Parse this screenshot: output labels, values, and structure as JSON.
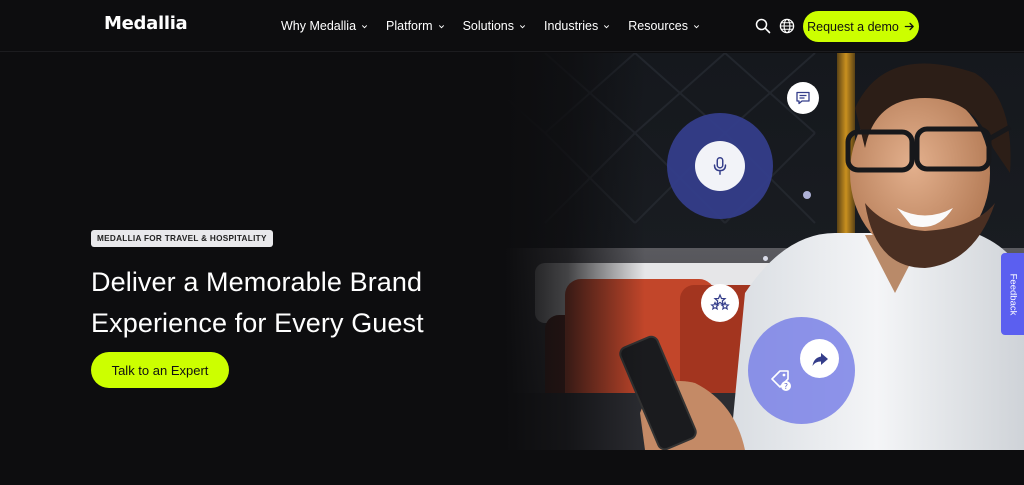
{
  "header": {
    "logo": "Medallia",
    "nav": [
      {
        "label": "Why Medallia"
      },
      {
        "label": "Platform"
      },
      {
        "label": "Solutions"
      },
      {
        "label": "Industries"
      },
      {
        "label": "Resources"
      }
    ],
    "icons": {
      "search": "search-icon",
      "language": "globe-icon"
    },
    "demo_button": "Request a demo"
  },
  "hero": {
    "eyebrow": "MEDALLIA FOR TRAVEL & HOSPITALITY",
    "headline_line1": "Deliver a Memorable Brand",
    "headline_line2": "Experience for Every Guest",
    "cta": "Talk to an Expert"
  },
  "feedback_tab": "Feedback",
  "colors": {
    "background": "#0d0d0f",
    "accent": "#ccff00",
    "feedback_tab": "#5b5ff0",
    "mic_disc": "#343d8a",
    "tag_disc": "#767ee6"
  }
}
